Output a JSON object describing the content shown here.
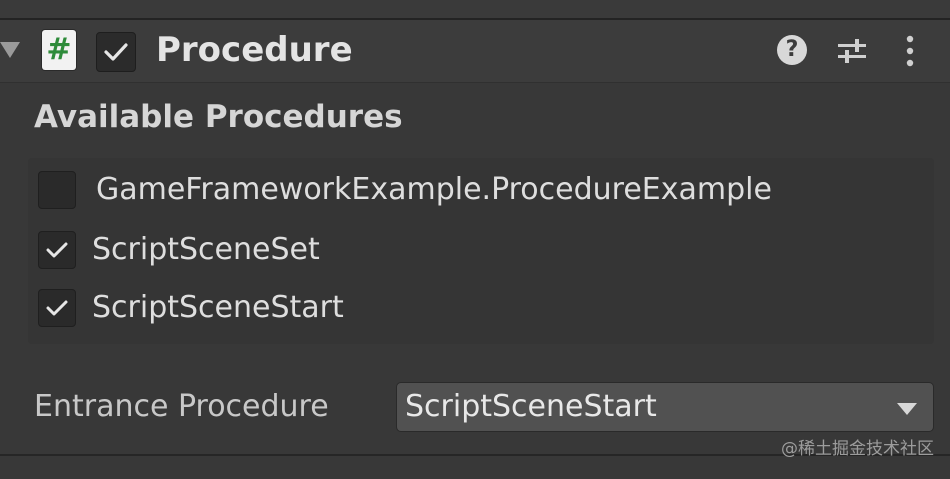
{
  "component": {
    "title": "Procedure",
    "enabled": true,
    "icons": {
      "script": "script-file-icon",
      "help": "help-icon",
      "presets": "presets-sliders-icon",
      "menu": "kebab-menu-icon"
    },
    "help_glyph": "?"
  },
  "available_procedures": {
    "label": "Available Procedures",
    "items": [
      {
        "label": "GameFrameworkExample.ProcedureExample",
        "checked": false
      },
      {
        "label": "ScriptSceneSet",
        "checked": true
      },
      {
        "label": "ScriptSceneStart",
        "checked": true
      }
    ]
  },
  "entrance_procedure": {
    "label": "Entrance Procedure",
    "value": "ScriptSceneStart"
  },
  "watermark": "@稀土掘金技术社区",
  "colors": {
    "background": "#383838",
    "header": "#3c3c3c",
    "text": "#dedede",
    "script_icon_accent": "#2e8b3a"
  }
}
